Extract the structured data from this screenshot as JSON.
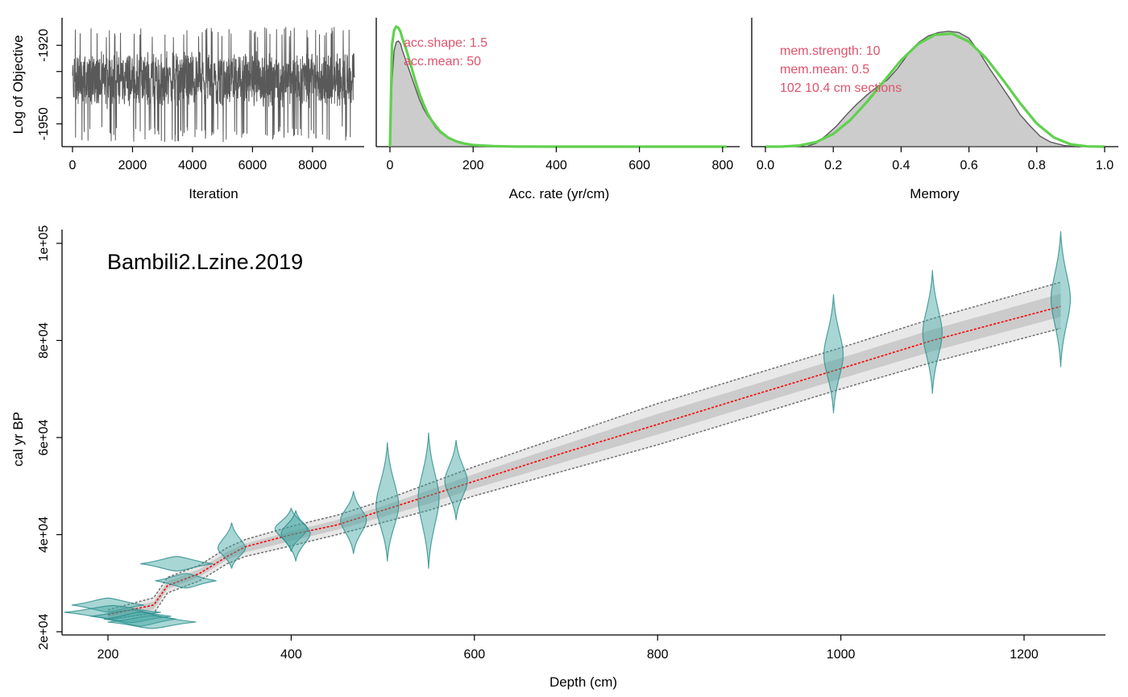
{
  "chart_data": [
    {
      "type": "line",
      "name": "trace",
      "xlabel": "Iteration",
      "ylabel": "Log of Objective",
      "xlim": [
        0,
        9400
      ],
      "ylim": [
        -1959,
        -1911
      ],
      "xticks": [
        0,
        2000,
        4000,
        6000,
        8000
      ],
      "xtick_labels": [
        "0",
        "2000",
        "4000",
        "6000",
        "8000"
      ],
      "yticks": [
        -1920,
        -1930,
        -1940,
        -1950
      ],
      "ytick_labels": [
        "-1920",
        "",
        "",
        "-1950"
      ],
      "series": [
        {
          "n": 9400,
          "center": -1933,
          "min": -1957,
          "max": -1913,
          "color": "#595959"
        }
      ]
    },
    {
      "type": "area",
      "name": "acc-rate",
      "xlabel": "Acc. rate (yr/cm)",
      "xlim": [
        0,
        810
      ],
      "xticks": [
        0,
        200,
        400,
        600,
        800
      ],
      "xtick_labels": [
        "0",
        "200",
        "400",
        "600",
        "800"
      ],
      "annotations": [
        "acc.shape:  1.5",
        "acc.mean:  50"
      ],
      "posterior": [
        [
          0,
          0
        ],
        [
          5,
          0.55
        ],
        [
          10,
          0.8
        ],
        [
          15,
          0.87
        ],
        [
          20,
          0.88
        ],
        [
          25,
          0.86
        ],
        [
          30,
          0.8
        ],
        [
          40,
          0.7
        ],
        [
          50,
          0.6
        ],
        [
          60,
          0.5
        ],
        [
          70,
          0.4
        ],
        [
          80,
          0.32
        ],
        [
          90,
          0.26
        ],
        [
          100,
          0.21
        ],
        [
          110,
          0.16
        ],
        [
          120,
          0.12
        ],
        [
          140,
          0.07
        ],
        [
          160,
          0.04
        ],
        [
          180,
          0.025
        ],
        [
          200,
          0.015
        ],
        [
          250,
          0.005
        ],
        [
          300,
          0.002
        ],
        [
          400,
          0.0005
        ],
        [
          810,
          0
        ]
      ],
      "prior": [
        [
          0,
          0
        ],
        [
          5,
          0.85
        ],
        [
          10,
          0.97
        ],
        [
          15,
          1.0
        ],
        [
          20,
          0.99
        ],
        [
          25,
          0.96
        ],
        [
          30,
          0.9
        ],
        [
          40,
          0.8
        ],
        [
          50,
          0.68
        ],
        [
          60,
          0.56
        ],
        [
          70,
          0.45
        ],
        [
          80,
          0.36
        ],
        [
          90,
          0.28
        ],
        [
          100,
          0.22
        ],
        [
          120,
          0.13
        ],
        [
          140,
          0.075
        ],
        [
          160,
          0.043
        ],
        [
          180,
          0.025
        ],
        [
          200,
          0.014
        ],
        [
          250,
          0.004
        ],
        [
          300,
          0.001
        ],
        [
          400,
          0.0002
        ],
        [
          810,
          0
        ]
      ],
      "ymax": 1.02,
      "colors": {
        "posterior_fill": "#cccccc",
        "posterior_line": "#595959",
        "prior": "#61d04f"
      }
    },
    {
      "type": "area",
      "name": "memory",
      "xlabel": "Memory",
      "xlim": [
        0,
        1
      ],
      "xticks": [
        0,
        0.2,
        0.4,
        0.6,
        0.8,
        1.0
      ],
      "xtick_labels": [
        "0.0",
        "0.2",
        "0.4",
        "0.6",
        "0.8",
        "1.0"
      ],
      "annotations": [
        "mem.strength: 10",
        "mem.mean: 0.5",
        "102 10.4 cm sections"
      ],
      "posterior": [
        [
          0.12,
          0
        ],
        [
          0.15,
          0.03
        ],
        [
          0.18,
          0.1
        ],
        [
          0.21,
          0.18
        ],
        [
          0.24,
          0.28
        ],
        [
          0.27,
          0.37
        ],
        [
          0.3,
          0.45
        ],
        [
          0.33,
          0.52
        ],
        [
          0.36,
          0.58
        ],
        [
          0.39,
          0.68
        ],
        [
          0.42,
          0.8
        ],
        [
          0.45,
          0.9
        ],
        [
          0.48,
          0.96
        ],
        [
          0.51,
          0.99
        ],
        [
          0.54,
          1.0
        ],
        [
          0.57,
          0.99
        ],
        [
          0.6,
          0.94
        ],
        [
          0.63,
          0.82
        ],
        [
          0.66,
          0.68
        ],
        [
          0.69,
          0.55
        ],
        [
          0.72,
          0.42
        ],
        [
          0.75,
          0.28
        ],
        [
          0.78,
          0.18
        ],
        [
          0.81,
          0.09
        ],
        [
          0.84,
          0.04
        ],
        [
          0.88,
          0.01
        ],
        [
          0.92,
          0
        ]
      ],
      "prior": [
        [
          0,
          0
        ],
        [
          0.05,
          0.001
        ],
        [
          0.1,
          0.01
        ],
        [
          0.15,
          0.04
        ],
        [
          0.2,
          0.11
        ],
        [
          0.25,
          0.23
        ],
        [
          0.3,
          0.39
        ],
        [
          0.35,
          0.57
        ],
        [
          0.4,
          0.75
        ],
        [
          0.45,
          0.89
        ],
        [
          0.5,
          0.97
        ],
        [
          0.55,
          0.98
        ],
        [
          0.6,
          0.91
        ],
        [
          0.65,
          0.77
        ],
        [
          0.7,
          0.58
        ],
        [
          0.75,
          0.38
        ],
        [
          0.8,
          0.2
        ],
        [
          0.85,
          0.08
        ],
        [
          0.9,
          0.02
        ],
        [
          0.95,
          0.002
        ],
        [
          1.0,
          0
        ]
      ],
      "ymax": 1.02,
      "colors": {
        "posterior_fill": "#cccccc",
        "posterior_line": "#595959",
        "prior": "#61d04f"
      }
    },
    {
      "type": "line",
      "name": "age-depth",
      "title": "Bambili2.Lzine.2019",
      "xlabel": "Depth (cm)",
      "ylabel": "cal yr BP",
      "xlim": [
        150,
        1380
      ],
      "ylim": [
        20000,
        103000
      ],
      "xticks": [
        200,
        400,
        600,
        800,
        1000,
        1200
      ],
      "xtick_labels": [
        "200",
        "400",
        "600",
        "800",
        "1000",
        "1200"
      ],
      "yticks": [
        20000,
        40000,
        60000,
        80000,
        100000
      ],
      "ytick_labels": [
        "2e+04",
        "4e+04",
        "6e+04",
        "8e+04",
        "1e+05"
      ],
      "median": [
        [
          200,
          23500
        ],
        [
          250,
          25500
        ],
        [
          265,
          29500
        ],
        [
          300,
          32000
        ],
        [
          330,
          35500
        ],
        [
          350,
          37500
        ],
        [
          400,
          40000
        ],
        [
          450,
          42000
        ],
        [
          500,
          45000
        ],
        [
          550,
          48000
        ],
        [
          600,
          51000
        ],
        [
          700,
          57000
        ],
        [
          800,
          62700
        ],
        [
          900,
          68500
        ],
        [
          1000,
          74200
        ],
        [
          1100,
          80000
        ],
        [
          1240,
          87000
        ]
      ],
      "lower": [
        [
          200,
          22500
        ],
        [
          250,
          23800
        ],
        [
          265,
          28000
        ],
        [
          300,
          30500
        ],
        [
          330,
          34000
        ],
        [
          350,
          35500
        ],
        [
          400,
          37700
        ],
        [
          450,
          40000
        ],
        [
          500,
          42500
        ],
        [
          550,
          45000
        ],
        [
          600,
          48000
        ],
        [
          800,
          58500
        ],
        [
          1000,
          70000
        ],
        [
          1100,
          75500
        ],
        [
          1240,
          82500
        ]
      ],
      "upper": [
        [
          200,
          24500
        ],
        [
          250,
          27000
        ],
        [
          265,
          31200
        ],
        [
          300,
          33700
        ],
        [
          330,
          37300
        ],
        [
          350,
          39000
        ],
        [
          400,
          41700
        ],
        [
          450,
          44000
        ],
        [
          500,
          47000
        ],
        [
          550,
          50500
        ],
        [
          600,
          54000
        ],
        [
          800,
          67000
        ],
        [
          1000,
          78500
        ],
        [
          1100,
          84500
        ],
        [
          1240,
          92000
        ]
      ],
      "dates": [
        {
          "depth": 200,
          "age": 25500,
          "lo": 23500,
          "hi": 27800,
          "hw": 45
        },
        {
          "depth": 205,
          "age": 24000,
          "lo": 21800,
          "hi": 26000,
          "hw": 60
        },
        {
          "depth": 225,
          "age": 23200,
          "lo": 21500,
          "hi": 25000,
          "hw": 50
        },
        {
          "depth": 235,
          "age": 22600,
          "lo": 20500,
          "hi": 24800,
          "hw": 45
        },
        {
          "depth": 248,
          "age": 22000,
          "lo": 20500,
          "hi": 23600,
          "hw": 55
        },
        {
          "depth": 275,
          "age": 34000,
          "lo": 31500,
          "hi": 36000,
          "hw": 45
        },
        {
          "depth": 285,
          "age": 30500,
          "lo": 28500,
          "hi": 33000,
          "hw": 38
        },
        {
          "depth": 335,
          "age": 37200,
          "lo": 33000,
          "hi": 42500,
          "hw": 17
        },
        {
          "depth": 400,
          "age": 41200,
          "lo": 36500,
          "hi": 45500,
          "hw": 20
        },
        {
          "depth": 405,
          "age": 40300,
          "lo": 34500,
          "hi": 45000,
          "hw": 18
        },
        {
          "depth": 468,
          "age": 43000,
          "lo": 36000,
          "hi": 49000,
          "hw": 16
        },
        {
          "depth": 505,
          "age": 46000,
          "lo": 34500,
          "hi": 59000,
          "hw": 14
        },
        {
          "depth": 550,
          "age": 47500,
          "lo": 33000,
          "hi": 61000,
          "hw": 13
        },
        {
          "depth": 580,
          "age": 51000,
          "lo": 43000,
          "hi": 59500,
          "hw": 14
        },
        {
          "depth": 992,
          "age": 77000,
          "lo": 65000,
          "hi": 89500,
          "hw": 12
        },
        {
          "depth": 1100,
          "age": 81500,
          "lo": 69000,
          "hi": 94500,
          "hw": 12
        },
        {
          "depth": 1240,
          "age": 88500,
          "lo": 74500,
          "hi": 102500,
          "hw": 12
        }
      ],
      "colors": {
        "median": "#ff0000",
        "bounds": "#707070",
        "dates_fill": "#3ea5a0",
        "dates_stroke": "#2b8c8c"
      }
    }
  ]
}
